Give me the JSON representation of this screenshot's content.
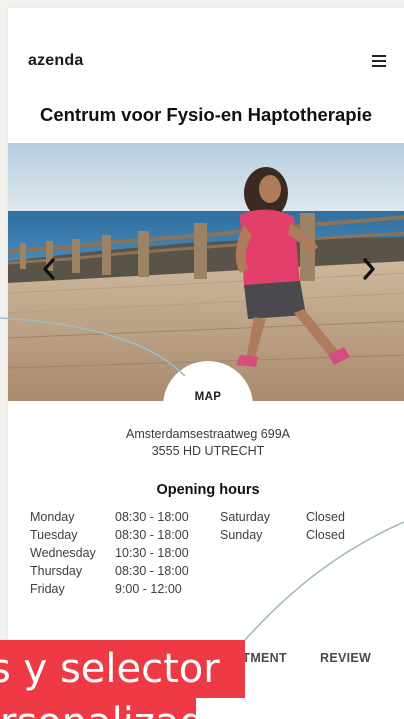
{
  "header": {
    "logo": "azenda",
    "menu_icon": "hamburger-menu-icon"
  },
  "page_title": "Centrum voor Fysio-en Haptotherapie",
  "carousel": {
    "prev_icon": "chevron-left-icon",
    "next_icon": "chevron-right-icon"
  },
  "map_button": {
    "label": "MAP"
  },
  "address": {
    "street": "Amsterdamsestraatweg 699A",
    "city": "3555 HD UTRECHT"
  },
  "opening_hours": {
    "title": "Opening hours",
    "left_column": [
      {
        "day": "Monday",
        "hours": "08:30 - 18:00"
      },
      {
        "day": "Tuesday",
        "hours": "08:30 - 18:00"
      },
      {
        "day": "Wednesday",
        "hours": "10:30 - 18:00"
      },
      {
        "day": "Thursday",
        "hours": "08:30 - 18:00"
      },
      {
        "day": "Friday",
        "hours": "9:00 - 12:00"
      }
    ],
    "right_column": [
      {
        "day": "Saturday",
        "hours": "Closed"
      },
      {
        "day": "Sunday",
        "hours": "Closed"
      }
    ]
  },
  "tabs": {
    "appointment": "ATMENT",
    "review": "REVIEW"
  },
  "promo_overlay": {
    "line1": "s y selector",
    "line2": "rsonalizado"
  },
  "colors": {
    "promo_red": "#ee3a44",
    "deco_line": "#9fbcc4",
    "page_bg": "#f3f2ee"
  }
}
